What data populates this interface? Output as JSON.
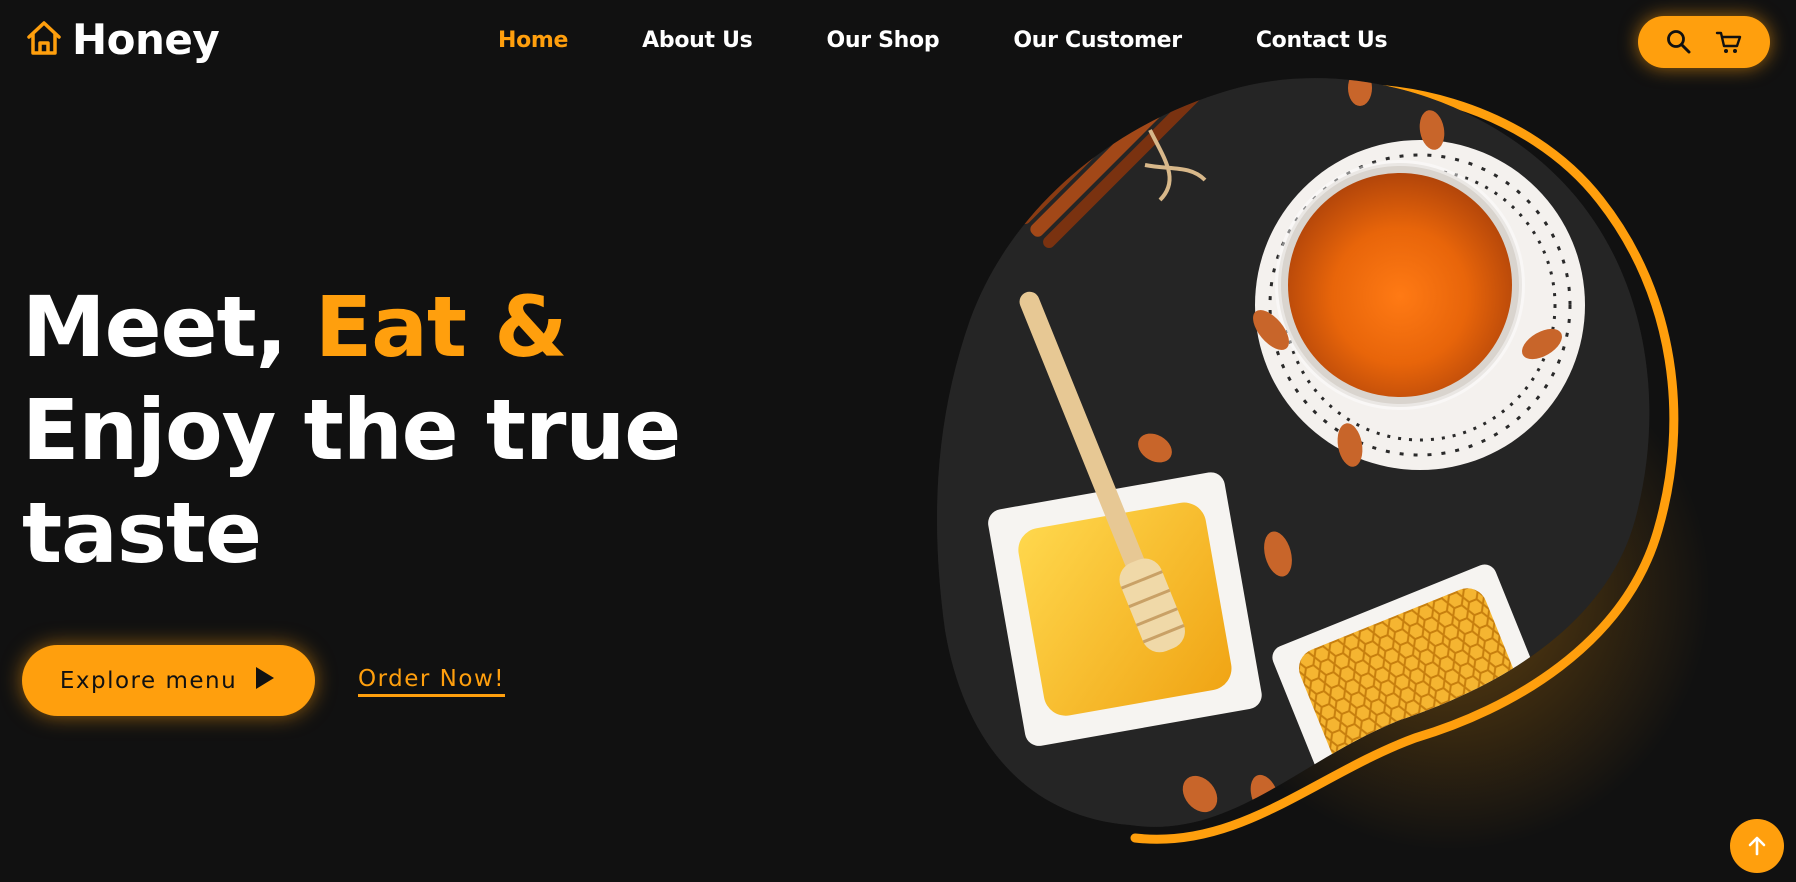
{
  "brand": {
    "name": "Honey",
    "icon": "home-icon"
  },
  "nav": {
    "items": [
      {
        "label": "Home",
        "active": true
      },
      {
        "label": "About Us",
        "active": false
      },
      {
        "label": "Our Shop",
        "active": false
      },
      {
        "label": "Our Customer",
        "active": false
      },
      {
        "label": "Contact Us",
        "active": false
      }
    ]
  },
  "header_actions": {
    "search_icon": "search-icon",
    "cart_icon": "cart-icon"
  },
  "hero": {
    "line1_white": "Meet, ",
    "line1_accent": "Eat &",
    "line2": "Enjoy the true",
    "line3": "taste",
    "explore_label": "Explore menu",
    "order_label": "Order Now!",
    "image": "honey-jar-honeycomb-almonds-photo"
  },
  "scroll_top_icon": "arrow-up-icon",
  "colors": {
    "accent": "#ff9f0d",
    "background": "#111111",
    "text": "#ffffff"
  }
}
